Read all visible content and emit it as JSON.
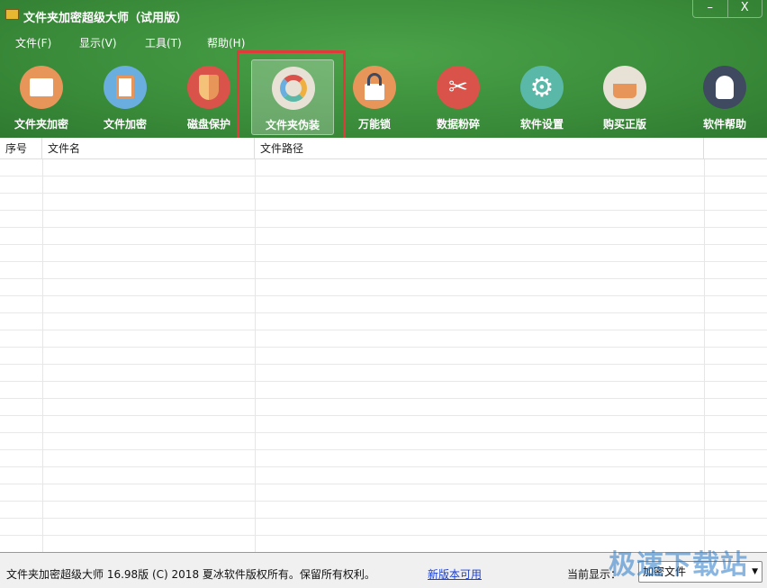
{
  "window": {
    "title": "文件夹加密超级大师（试用版）",
    "minimize": "–",
    "close": "X"
  },
  "menu": [
    {
      "label": "文件(F)"
    },
    {
      "label": "显示(V)"
    },
    {
      "label": "工具(T)"
    },
    {
      "label": "帮助(H)"
    }
  ],
  "toolbar": [
    {
      "label": "文件夹加密",
      "icon": "folder-icon",
      "color": "#e8955a"
    },
    {
      "label": "文件加密",
      "icon": "clipboard-icon",
      "color": "#6aaee0"
    },
    {
      "label": "磁盘保护",
      "icon": "shield-icon",
      "color": "#d9534a"
    },
    {
      "label": "文件夹伪装",
      "icon": "palette-icon",
      "color": "#e8e2d6",
      "selected": true
    },
    {
      "label": "万能锁",
      "icon": "lock-icon",
      "color": "#e8955a"
    },
    {
      "label": "数据粉碎",
      "icon": "scissors-icon",
      "color": "#d9534a"
    },
    {
      "label": "软件设置",
      "icon": "gear-icon",
      "color": "#5ab8a8"
    },
    {
      "label": "购买正版",
      "icon": "basket-icon",
      "color": "#e8e2d6"
    },
    {
      "label": "软件帮助",
      "icon": "user-icon",
      "color": "#3f4a60"
    }
  ],
  "table": {
    "columns": [
      "序号",
      "文件名",
      "文件路径",
      ""
    ],
    "rows": []
  },
  "status": {
    "copyright": "文件夹加密超级大师 16.98版 (C) 2018  夏冰软件版权所有。保留所有权利。",
    "update_link": "新版本可用",
    "current_label": "当前显示：",
    "current_value": "加密文件"
  },
  "watermark": "极速下载站"
}
